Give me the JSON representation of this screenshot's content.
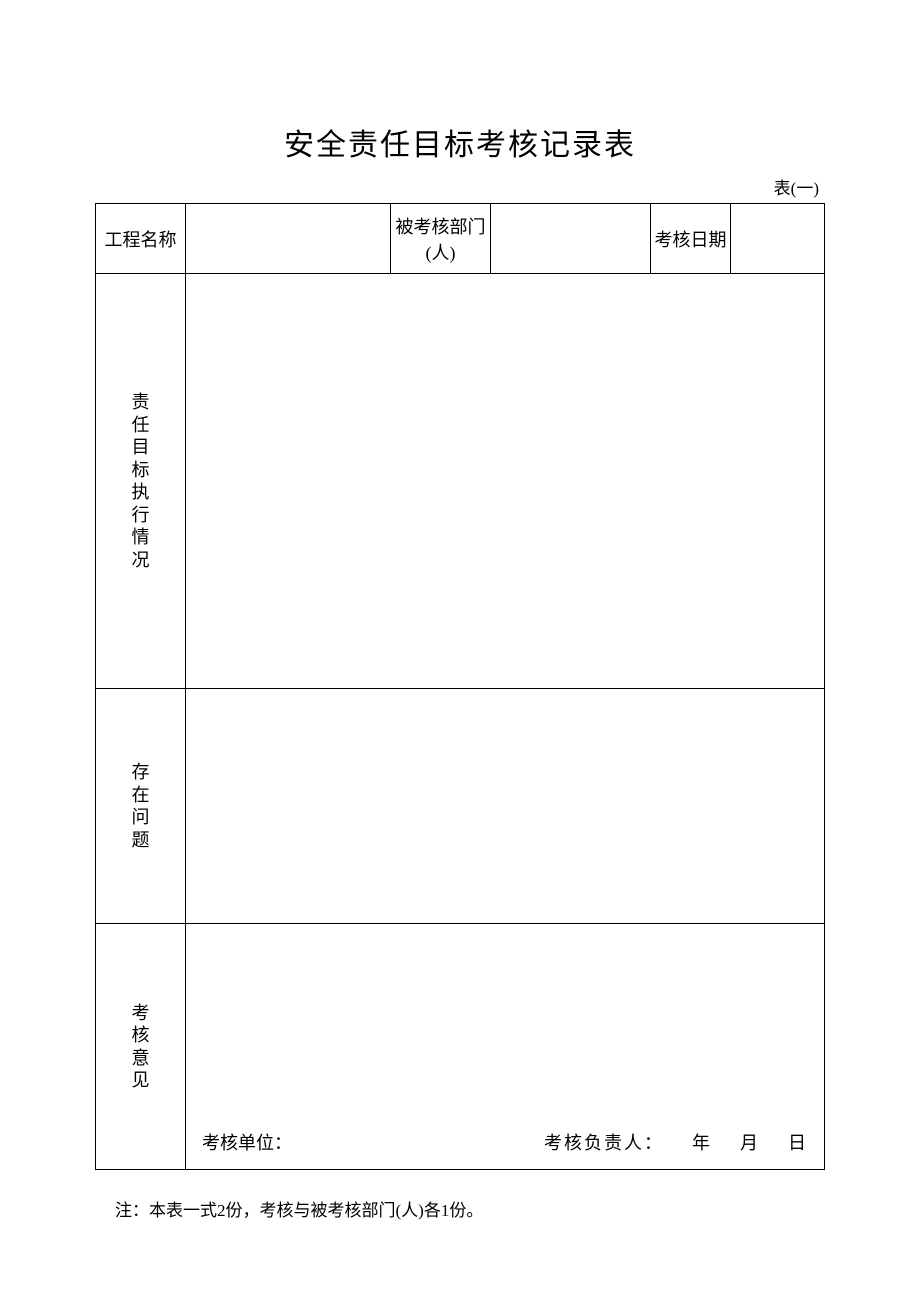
{
  "title": "安全责任目标考核记录表",
  "table_label": "表(一)",
  "header": {
    "project_name_label": "工程名称",
    "project_name_value": "",
    "assessed_dept_label_l1": "被考核部门",
    "assessed_dept_label_l2": "(人)",
    "assessed_dept_value": "",
    "assess_date_label": "考核日期",
    "assess_date_value": ""
  },
  "rows": {
    "execution_label_chars": [
      "责",
      "任",
      "目",
      "标",
      "执",
      "行",
      "情",
      "况"
    ],
    "execution_value": "",
    "issues_label_chars": [
      "存",
      "在",
      "问",
      "题"
    ],
    "issues_value": "",
    "opinion_label_chars": [
      "考",
      "核",
      "意",
      "见"
    ],
    "opinion_value": ""
  },
  "footer_in_cell": {
    "unit_label": "考核单位：",
    "responsible_label": "考核负责人：",
    "year_char": "年",
    "month_char": "月",
    "day_char": "日"
  },
  "note": "注：本表一式2份，考核与被考核部门(人)各1份。"
}
